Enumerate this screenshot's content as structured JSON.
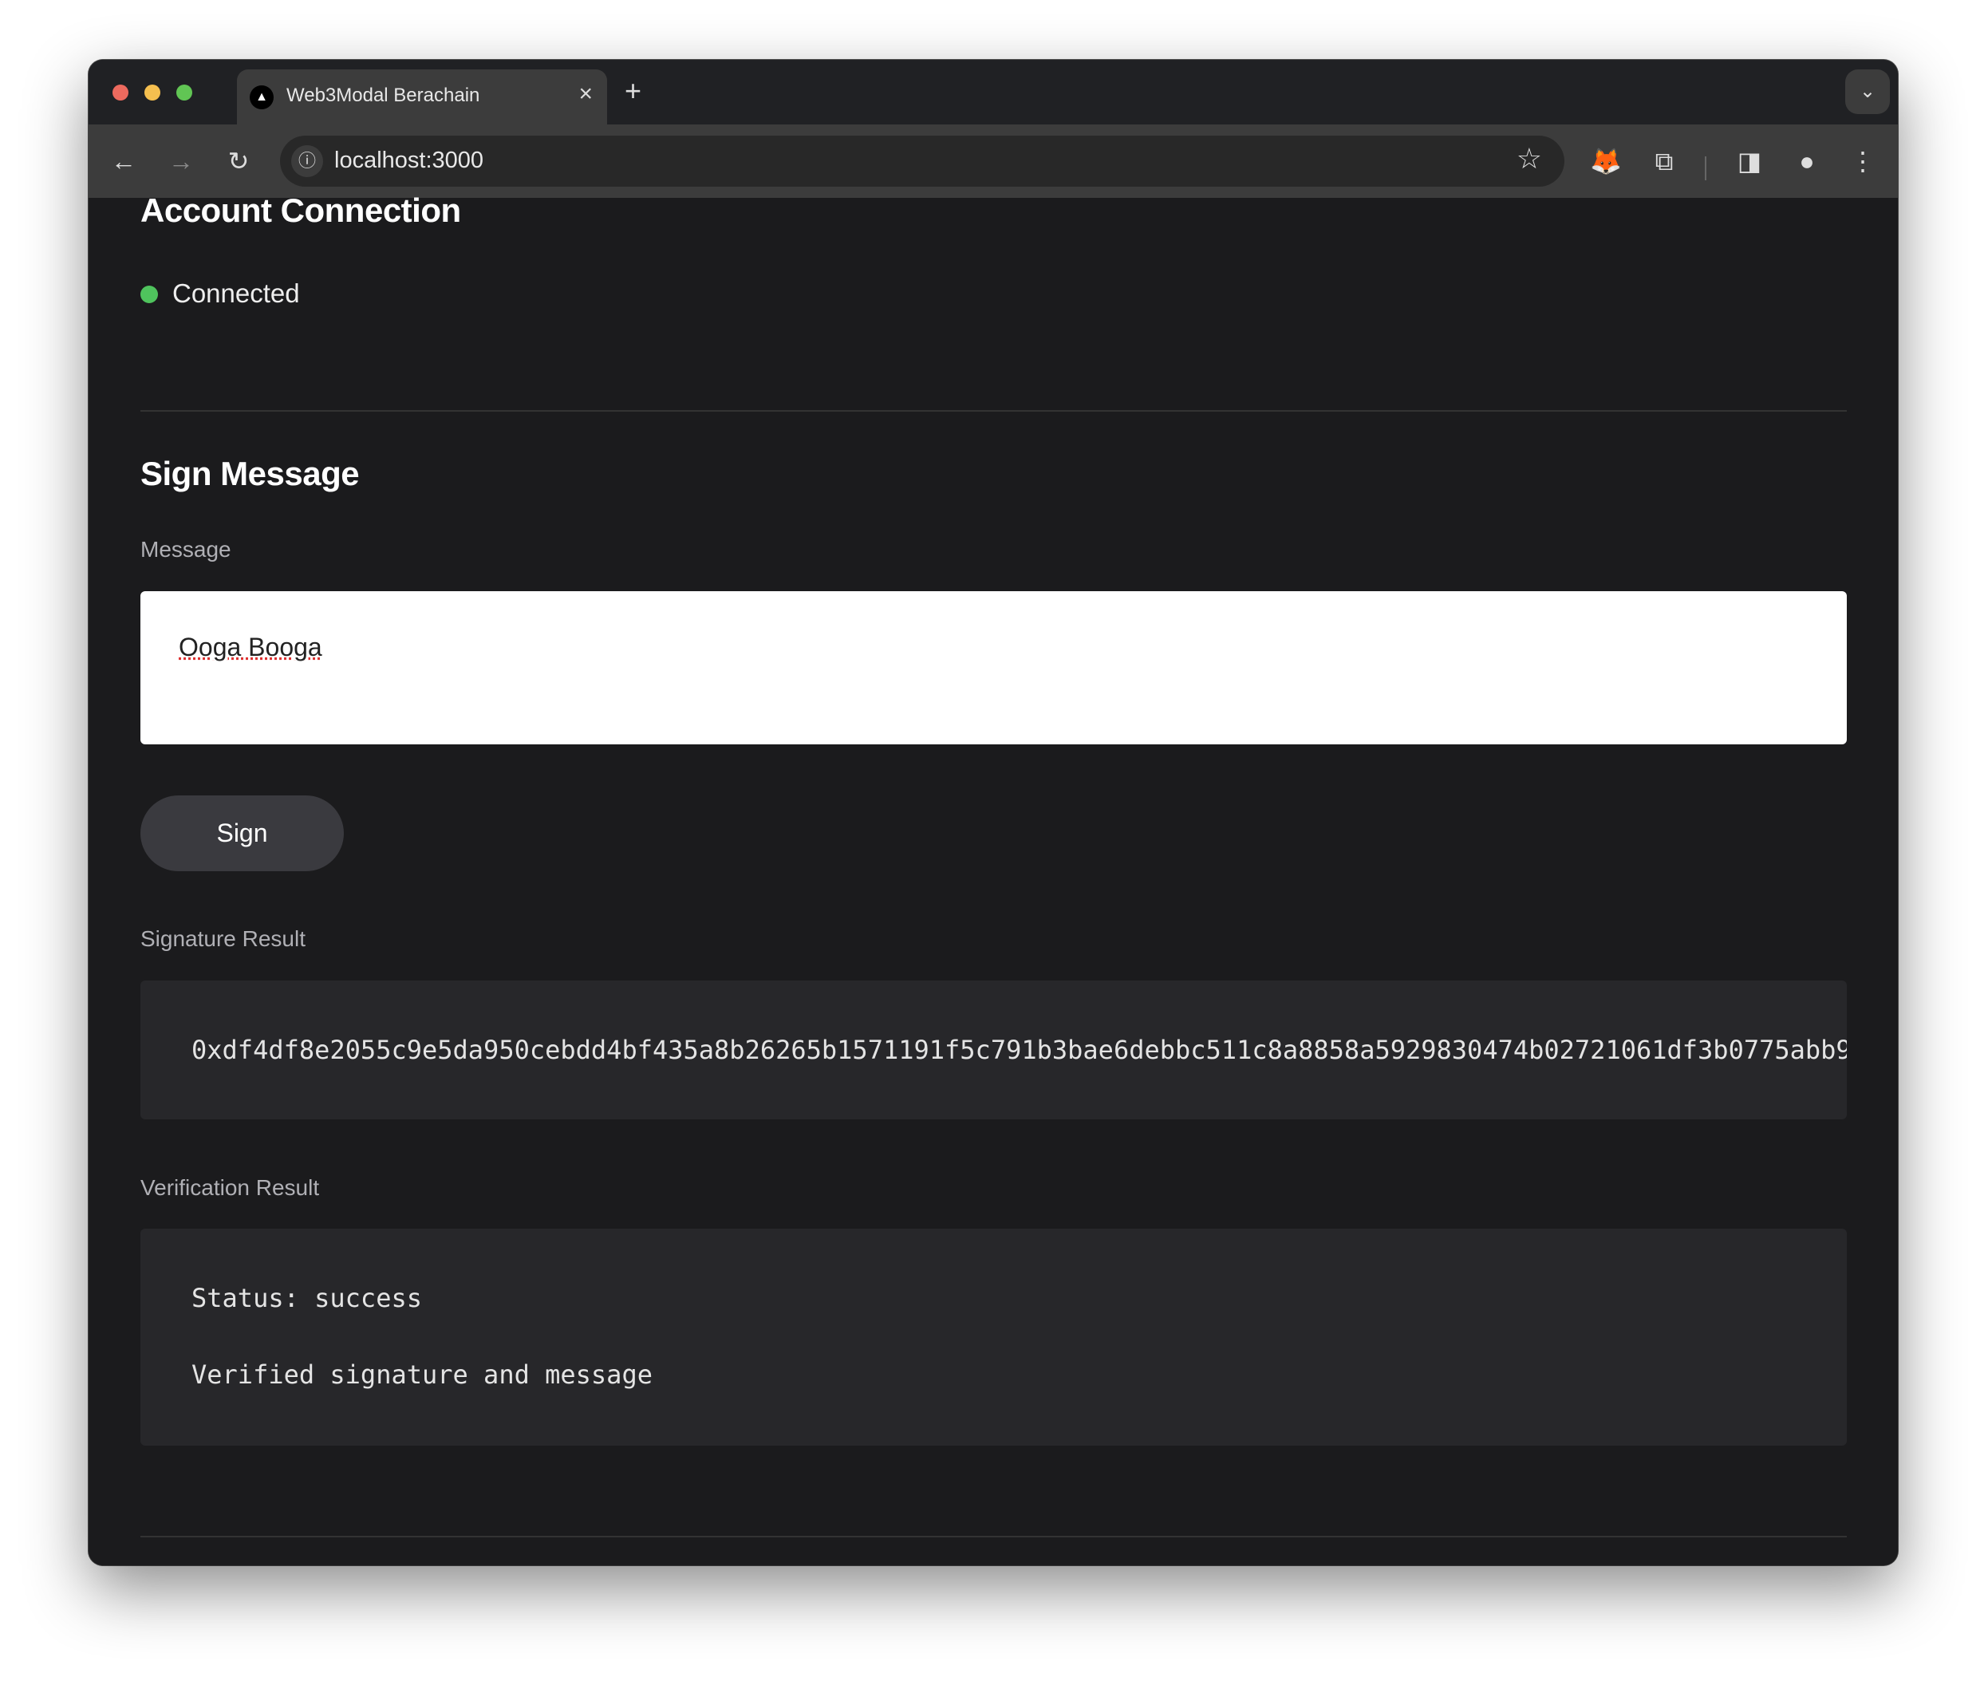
{
  "browser": {
    "tab_title": "Web3Modal Berachain",
    "url": "localhost:3000",
    "colors": {
      "close": "#ed6a5e",
      "minimize": "#f5bf4f",
      "maximize": "#61c554"
    }
  },
  "account": {
    "title": "Account Connection",
    "status": "Connected",
    "status_color": "#4fc35d"
  },
  "sign": {
    "title": "Sign Message",
    "message_label": "Message",
    "message_value": "Ooga Booga",
    "button_label": "Sign",
    "signature_label": "Signature Result",
    "signature_value": "0xdf4df8e2055c9e5da950cebdd4bf435a8b26265b1571191f5c791b3bae6debbc511c8a8858a5929830474b02721061df3b0775abb9",
    "verification_label": "Verification Result",
    "verification_status": "Status: success",
    "verification_message": "Verified signature and message"
  }
}
